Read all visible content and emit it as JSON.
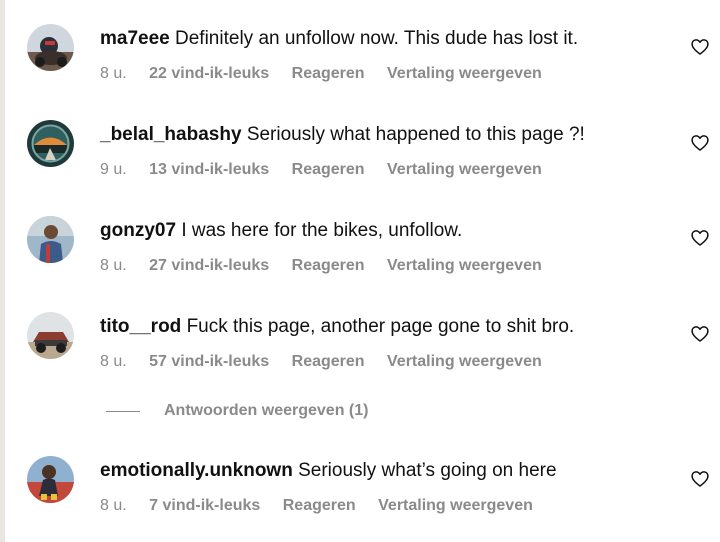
{
  "comments": [
    {
      "username": "ma7eee",
      "text": "Definitely an unfollow now. This dude has lost it.",
      "time": "8 u.",
      "likes": "22 vind-ik-leuks",
      "reply_label": "Reageren",
      "translate_label": "Vertaling weergeven"
    },
    {
      "username": "_belal_habashy",
      "text": "Seriously what happened to this page ?!",
      "time": "9 u.",
      "likes": "13 vind-ik-leuks",
      "reply_label": "Reageren",
      "translate_label": "Vertaling weergeven"
    },
    {
      "username": "gonzy07",
      "text": "I was here for the bikes, unfollow.",
      "time": "8 u.",
      "likes": "27 vind-ik-leuks",
      "reply_label": "Reageren",
      "translate_label": "Vertaling weergeven"
    },
    {
      "username": "tito__rod",
      "text": "Fuck this page, another page gone to shit bro.",
      "time": "8 u.",
      "likes": "57 vind-ik-leuks",
      "reply_label": "Reageren",
      "translate_label": "Vertaling weergeven"
    },
    {
      "username": "emotionally.unknown",
      "text": "Seriously what’s going on here",
      "time": "8 u.",
      "likes": "7 vind-ik-leuks",
      "reply_label": "Reageren",
      "translate_label": "Vertaling weergeven"
    }
  ],
  "view_replies_label": "Antwoorden weergeven (1)",
  "icons": {
    "like": "heart-outline-icon"
  },
  "colors": {
    "text": "#111111",
    "meta": "#8a8a8a",
    "background": "#ffffff"
  }
}
